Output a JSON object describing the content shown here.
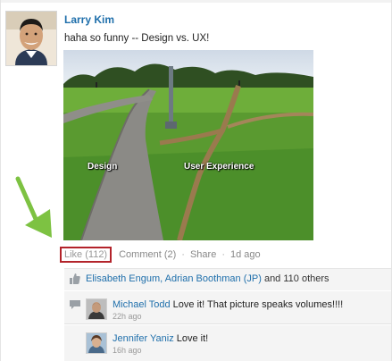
{
  "post": {
    "author": "Larry Kim",
    "text": "haha so funny -- Design vs. UX!",
    "image": {
      "label_left": "Design",
      "label_right": "User Experience"
    }
  },
  "actions": {
    "like": "Like (112)",
    "comment": "Comment (2)",
    "share": "Share",
    "separator": "·",
    "time": "1d ago"
  },
  "likes": {
    "names": "Elisabeth Engum, Adrian Boothman (JP)",
    "others": " and 110 others"
  },
  "comments": [
    {
      "author": "Michael Todd",
      "text": " Love it! That picture speaks volumes!!!!",
      "time": "22h ago"
    },
    {
      "author": "Jennifer Yaniz",
      "text": " Love it!",
      "time": "16h ago"
    }
  ],
  "colors": {
    "link": "#1f6fab",
    "highlight_border": "#b3232a",
    "arrow": "#7dc242"
  },
  "icons": {
    "like": "thumbs-up-icon",
    "comment": "speech-bubble-icon",
    "annotation": "green-arrow-icon"
  }
}
